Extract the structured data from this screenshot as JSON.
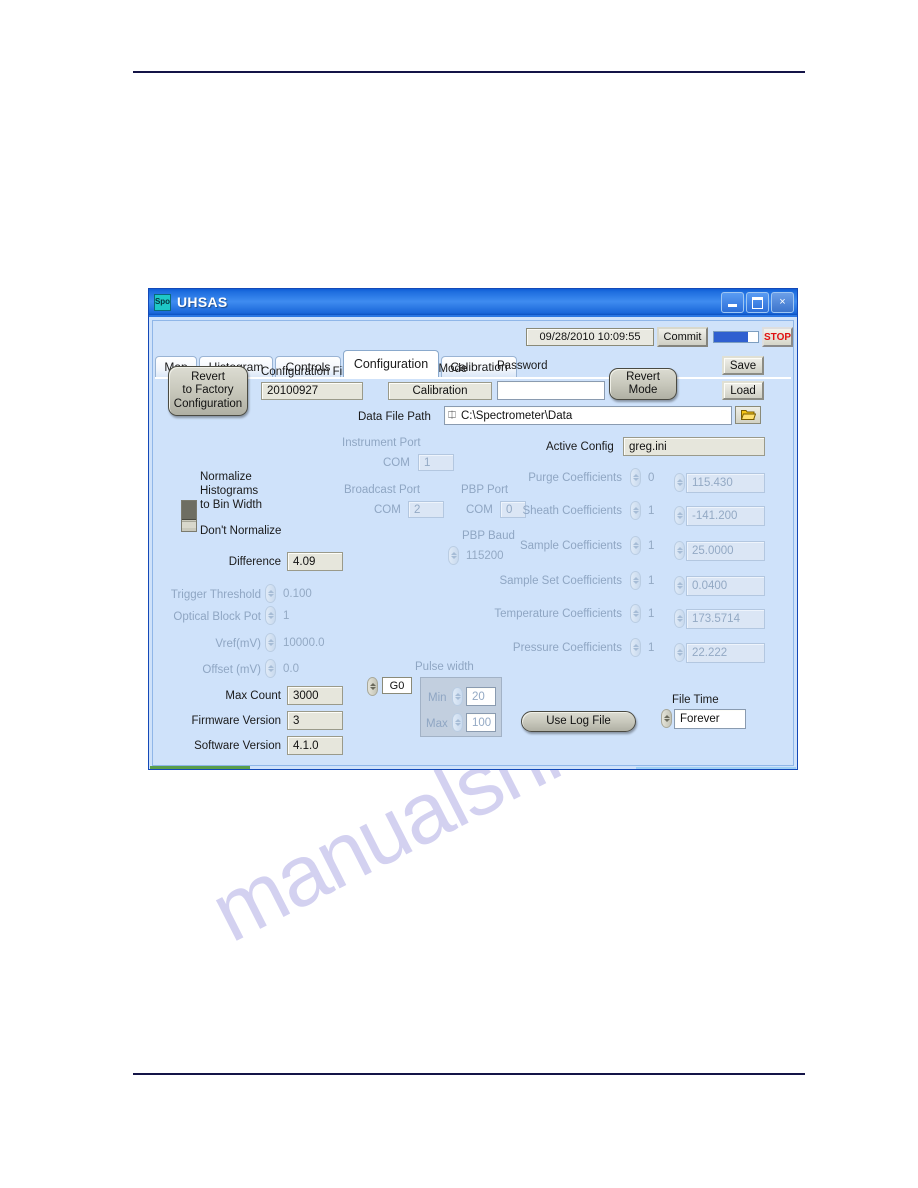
{
  "window": {
    "title": "UHSAS",
    "app_icon": "spectrometer-icon",
    "icon_text": "Spo",
    "buttons": {
      "minimize": "minimize-icon",
      "maximize": "maximize-icon",
      "close": "×"
    }
  },
  "tabs": [
    {
      "label": "Map",
      "active": false
    },
    {
      "label": "Histogram",
      "active": false
    },
    {
      "label": "Controls",
      "active": false
    },
    {
      "label": "Configuration",
      "active": true
    },
    {
      "label": "Calibration",
      "active": false
    }
  ],
  "header": {
    "datetime": "09/28/2010  10:09:55",
    "commit_label": "Commit",
    "stop_label": "STOP",
    "progress_percent": 78
  },
  "side_buttons": {
    "save": "Save",
    "load": "Load"
  },
  "top": {
    "revert_factory_line1": "Revert",
    "revert_factory_line2": "to Factory",
    "revert_factory_line3": "Configuration",
    "config_file_date_label": "Configuration File Date",
    "config_file_date_value": "20100927",
    "user_mode_label": "User Mode",
    "user_mode_value": "Calibration",
    "password_label": "Password",
    "password_value": "",
    "revert_mode_line1": "Revert",
    "revert_mode_line2": "Mode",
    "data_file_path_label": "Data File Path",
    "data_file_path_value": "C:\\Spectrometer\\Data",
    "folder_icon": "open-folder-icon"
  },
  "ports": {
    "instrument_port_label": "Instrument Port",
    "instrument_port_prefix": "COM",
    "instrument_port_value": "1",
    "broadcast_port_label": "Broadcast Port",
    "broadcast_port_prefix": "COM",
    "broadcast_port_value": "2",
    "pbp_port_label": "PBP Port",
    "pbp_port_prefix": "COM",
    "pbp_port_value": "0",
    "pbp_baud_label": "PBP Baud",
    "pbp_baud_value": "115200"
  },
  "normalize": {
    "top_line1": "Normalize",
    "top_line2": "Histograms",
    "top_line3": "to Bin Width",
    "bottom": "Don't Normalize"
  },
  "left_fields": [
    {
      "label": "Difference",
      "value": "4.09",
      "spinner": false,
      "dim": false
    },
    {
      "label": "Trigger Threshold",
      "value": "0.100",
      "spinner": true,
      "dim": true
    },
    {
      "label": "Optical Block Pot",
      "value": "1",
      "spinner": true,
      "dim": true
    },
    {
      "label": "Vref(mV)",
      "value": "10000.0",
      "spinner": true,
      "dim": true
    },
    {
      "label": "Offset (mV)",
      "value": "0.0",
      "spinner": true,
      "dim": true
    },
    {
      "label": "Max Count",
      "value": "3000",
      "spinner": false,
      "dim": false
    },
    {
      "label": "Firmware Version",
      "value": "3",
      "spinner": false,
      "dim": false
    },
    {
      "label": "Software Version",
      "value": "4.1.0",
      "spinner": false,
      "dim": false
    }
  ],
  "active_config": {
    "label": "Active Config",
    "value": "greg.ini"
  },
  "coefficients": [
    {
      "label": "Purge Coefficients",
      "index": "0",
      "value": "115.430"
    },
    {
      "label": "Sheath Coefficients",
      "index": "1",
      "value": "-141.200"
    },
    {
      "label": "Sample Coefficients",
      "index": "1",
      "value": "25.0000"
    },
    {
      "label": "Sample Set Coefficients",
      "index": "1",
      "value": "0.0400"
    },
    {
      "label": "Temperature Coefficients",
      "index": "1",
      "value": "173.5714"
    },
    {
      "label": "Pressure Coefficients",
      "index": "1",
      "value": "22.222"
    }
  ],
  "gain": {
    "value": "G0"
  },
  "pulse_width": {
    "title": "Pulse width",
    "min_label": "Min",
    "min_value": "20",
    "max_label": "Max",
    "max_value": "100"
  },
  "log": {
    "use_log_file": "Use Log File",
    "file_time_label": "File Time",
    "file_time_value": "Forever"
  },
  "watermark": {
    "text": "manualshive.com"
  },
  "colors": {
    "title_blue": "#1f6fe0",
    "panel_blue": "#cfe2fa",
    "stop_red": "#e01010",
    "accent_green": "#5a9e4a",
    "watermark": "#b9b6e8",
    "rule_navy": "#141447"
  }
}
